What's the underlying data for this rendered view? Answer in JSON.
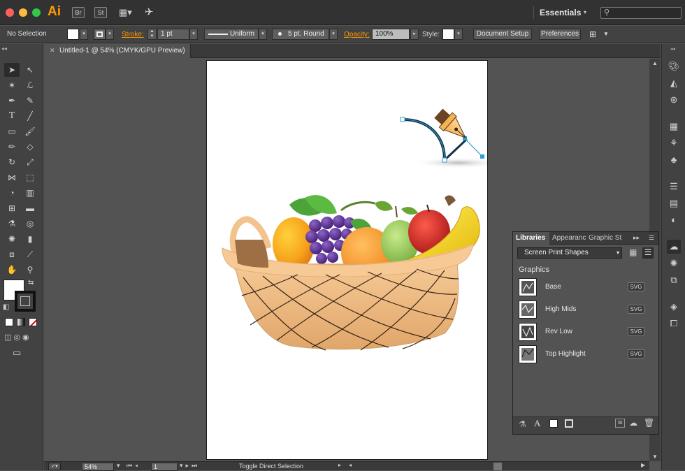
{
  "app": {
    "logo": "Ai",
    "bridge": "Br",
    "stock": "St",
    "workspace": "Essentials"
  },
  "control_bar": {
    "selection": "No Selection",
    "stroke_label": "Stroke:",
    "stroke_weight": "1 pt",
    "profile": "Uniform",
    "brush": "5 pt. Round",
    "opacity_label": "Opacity:",
    "opacity": "100%",
    "style_label": "Style:",
    "doc_setup": "Document Setup",
    "preferences": "Preferences"
  },
  "document": {
    "tab_title": "Untitled-1 @ 54% (CMYK/GPU Preview)"
  },
  "status_bar": {
    "zoom": "54%",
    "artboard": "1",
    "tool_hint": "Toggle Direct Selection"
  },
  "libraries": {
    "tabs": [
      "Libraries",
      "Appearance",
      "Graphic St"
    ],
    "library_name": "Screen Print Shapes",
    "section": "Graphics",
    "items": [
      {
        "name": "Base",
        "type": "SVG"
      },
      {
        "name": "High Mids",
        "type": "SVG"
      },
      {
        "name": "Rev Low",
        "type": "SVG"
      },
      {
        "name": "Top Highlight",
        "type": "SVG"
      }
    ]
  },
  "colors": {
    "accent_orange": "#ff9a00",
    "path_blue": "#2aa0d0",
    "basket": "#e9b47c"
  }
}
